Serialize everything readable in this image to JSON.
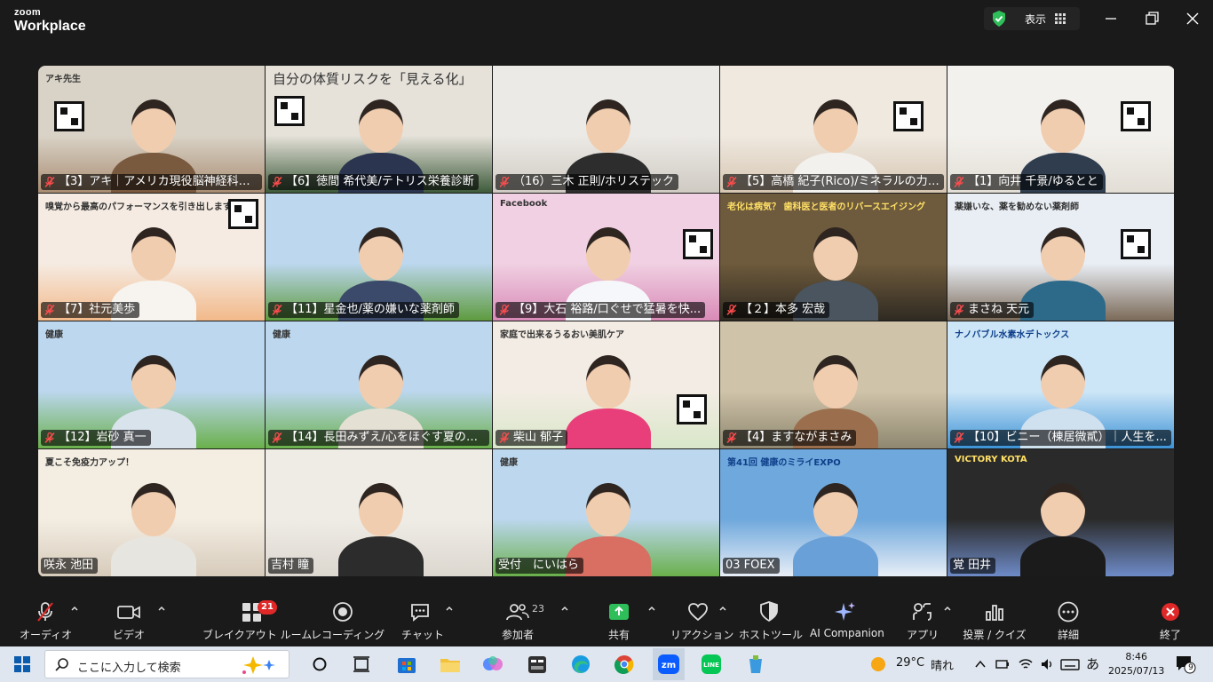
{
  "app": {
    "logo_top": "zoom",
    "logo_bottom": "Workplace",
    "view_label": "表示"
  },
  "tiles": [
    {
      "name": "【3】アキ｜アメリカ現役脳神経科学...",
      "banner": "アキ先生"
    },
    {
      "name": "【6】徳間 希代美/テトリス栄養診断",
      "banner": "自分の体質リスクを「見える化」"
    },
    {
      "name": "（16）三木 正則/ホリステック",
      "banner": ""
    },
    {
      "name": "【5】高橋 紀子(Rico)/ミネラルの力で夏...",
      "banner": ""
    },
    {
      "name": "【1】向井 千景/ゆるとと",
      "banner": ""
    },
    {
      "name": "【7】社元美歩",
      "banner": "嗅覚から最高のパフォーマンスを引き出します"
    },
    {
      "name": "【11】星金也/薬の嫌いな薬剤師",
      "banner": ""
    },
    {
      "name": "【9】大石 裕路/口ぐせで猛暑を快...",
      "banner": "Facebook"
    },
    {
      "name": "【２】本多 宏哉",
      "banner": "老化は病気？ 歯科医と医者のリバースエイジング"
    },
    {
      "name": "まさね 天元",
      "banner": "薬嫌いな、薬を勧めない薬剤師"
    },
    {
      "name": "【12】岩砂 真一",
      "banner": "健康"
    },
    {
      "name": "【14】長田みずえ/心をほぐす夏の習...",
      "banner": "健康"
    },
    {
      "name": "柴山 郁子",
      "banner": "家庭で出来るうるおい美肌ケア"
    },
    {
      "name": "【4】ますながまさみ",
      "banner": ""
    },
    {
      "name": "【10】ビニー（棟居微貳）｜人生を...",
      "banner": "ナノバブル水素水デトックス"
    },
    {
      "name": "咲永 池田",
      "banner": "夏こそ免疫力アップ！"
    },
    {
      "name": "吉村 瞳",
      "banner": ""
    },
    {
      "name": "受付　にいはら",
      "banner": "健康"
    },
    {
      "name": "03 FOEX",
      "banner": "第41回 健康のミライEXPO"
    },
    {
      "name": "覚 田井",
      "banner": "VICTORY KOTA"
    }
  ],
  "toolbar": {
    "audio": "オーディオ",
    "video": "ビデオ",
    "breakout": "ブレイクアウト ルーム",
    "breakout_badge": "21",
    "record": "レコーディング",
    "chat": "チャット",
    "participants": "参加者",
    "participants_count": "23",
    "share": "共有",
    "reactions": "リアクション",
    "host_tools": "ホストツール",
    "ai": "AI Companion",
    "apps": "アプリ",
    "poll": "投票 / クイズ",
    "more": "詳細",
    "end": "終了"
  },
  "taskbar": {
    "search_placeholder": "ここに入力して検索",
    "temp": "29°C",
    "weather": "晴れ",
    "ime": "あ",
    "time": "8:46",
    "date": "2025/07/13",
    "notif": "9"
  }
}
